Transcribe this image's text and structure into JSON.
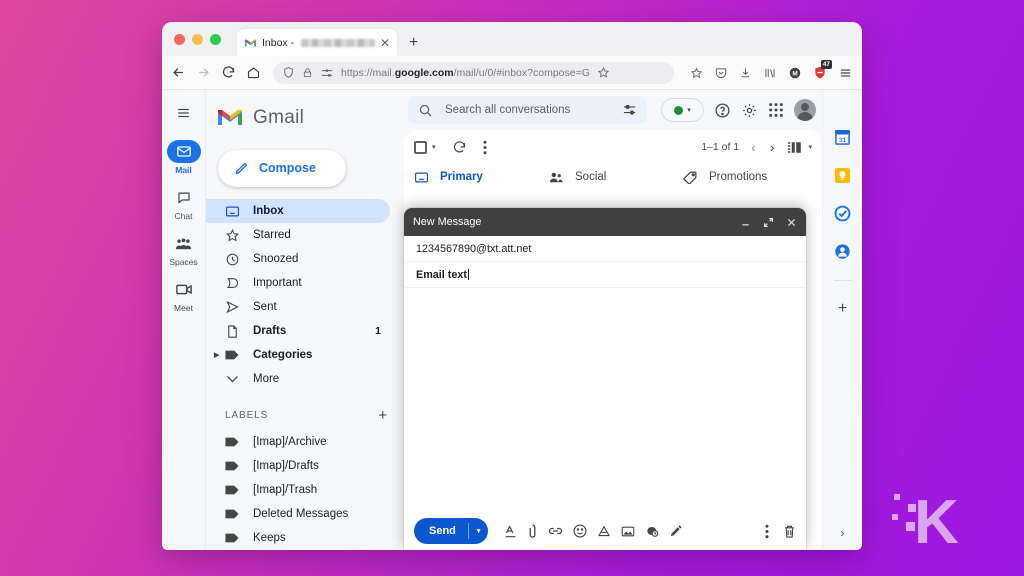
{
  "browser": {
    "tab": {
      "favicon": "gmail-favicon",
      "title": "Inbox - ",
      "redacted": true,
      "close": "✕"
    },
    "newtab_label": "+",
    "nav": {
      "back": "back-arrow",
      "forward": "forward-arrow",
      "reload": "reload",
      "home": "home"
    },
    "omnibox": {
      "shield": "shield-icon",
      "lock": "lock-icon",
      "tracking": "tracking-protection-icon",
      "url_prefix": "https://mail.",
      "url_domain": "google.com",
      "url_suffix": "/mail/u/0/#inbox?compose=G",
      "bookmark": "star-icon"
    },
    "extensions": [
      {
        "name": "pocket-save-icon"
      },
      {
        "name": "pocket-icon"
      },
      {
        "name": "download-icon"
      },
      {
        "name": "library-icon"
      },
      {
        "name": "account-m-icon"
      },
      {
        "name": "adblock-icon",
        "badge": "47"
      }
    ],
    "menu": "hamburger-menu-icon"
  },
  "gmail": {
    "brand": "Gmail",
    "menu_icon": "main-menu-icon",
    "rail": [
      {
        "label": "Mail",
        "icon": "mail-icon",
        "active": true
      },
      {
        "label": "Chat",
        "icon": "chat-icon",
        "active": false
      },
      {
        "label": "Spaces",
        "icon": "spaces-icon",
        "active": false
      },
      {
        "label": "Meet",
        "icon": "meet-icon",
        "active": false
      }
    ],
    "compose_label": "Compose",
    "folders": [
      {
        "label": "Inbox",
        "icon": "inbox-icon",
        "selected": true,
        "count": ""
      },
      {
        "label": "Starred",
        "icon": "star-icon",
        "selected": false,
        "count": ""
      },
      {
        "label": "Snoozed",
        "icon": "clock-icon",
        "selected": false,
        "count": ""
      },
      {
        "label": "Important",
        "icon": "important-icon",
        "selected": false,
        "count": ""
      },
      {
        "label": "Sent",
        "icon": "send-icon",
        "selected": false,
        "count": ""
      },
      {
        "label": "Drafts",
        "icon": "draft-icon",
        "selected": false,
        "count": "1",
        "bold": true
      },
      {
        "label": "Categories",
        "icon": "label-icon",
        "selected": false,
        "count": "",
        "bold": true,
        "expandable": true
      },
      {
        "label": "More",
        "icon": "chevron-down-icon",
        "selected": false,
        "count": ""
      }
    ],
    "labels_header": "LABELS",
    "labels_add": "+",
    "labels": [
      {
        "label": "[Imap]/Archive",
        "icon": "label-icon"
      },
      {
        "label": "[Imap]/Drafts",
        "icon": "label-icon"
      },
      {
        "label": "[Imap]/Trash",
        "icon": "label-icon"
      },
      {
        "label": "Deleted Messages",
        "icon": "label-icon"
      },
      {
        "label": "Keeps",
        "icon": "label-icon"
      }
    ],
    "search": {
      "placeholder": "Search all conversations",
      "search_icon": "search-icon",
      "options_icon": "search-options-icon"
    },
    "topright": {
      "status_dot_color": "#1e8e3e",
      "status_caret": "▾",
      "help_icon": "help-icon",
      "settings_icon": "gear-icon",
      "apps_icon": "google-apps-icon",
      "avatar": "avatar"
    },
    "listtools": {
      "select_all": "select-all-checkbox",
      "select_caret": "▾",
      "refresh_icon": "refresh-icon",
      "more_icon": "more-options-icon",
      "pagination": "1–1 of 1",
      "prev": "‹",
      "next": "›",
      "split_view_icon": "split-pane-icon",
      "split_caret": "▾"
    },
    "tabs": [
      {
        "label": "Primary",
        "icon": "inbox-icon",
        "active": true
      },
      {
        "label": "Social",
        "icon": "social-icon",
        "active": false
      },
      {
        "label": "Promotions",
        "icon": "promotions-tag-icon",
        "active": false
      }
    ],
    "right_rail": [
      {
        "name": "google-calendar-icon"
      },
      {
        "name": "google-keep-icon"
      },
      {
        "name": "google-tasks-icon"
      },
      {
        "name": "google-contacts-icon"
      }
    ],
    "right_rail_add": "+",
    "right_rail_expand": "›"
  },
  "compose": {
    "title": "New Message",
    "minimize": "minimize-icon",
    "expand": "expand-icon",
    "close": "close-icon",
    "to_value": "1234567890@txt.att.net",
    "subject_value": "Email text",
    "body_value": "",
    "send_label": "Send",
    "send_caret": "▾",
    "tools": [
      {
        "name": "format-text-icon",
        "glyph": "A"
      },
      {
        "name": "attach-file-icon"
      },
      {
        "name": "insert-link-icon"
      },
      {
        "name": "insert-emoji-icon"
      },
      {
        "name": "insert-drive-icon"
      },
      {
        "name": "insert-photo-icon"
      },
      {
        "name": "confidential-mode-icon"
      },
      {
        "name": "insert-signature-icon"
      }
    ],
    "more_options": "more-options-icon",
    "discard": "trash-icon"
  },
  "watermark": {
    "glyph": "K"
  },
  "colors": {
    "accent_blue": "#0b57d0",
    "compose_header": "#404040",
    "bg_gradient_start": "#e0479f",
    "bg_gradient_end": "#9b18e0",
    "status_green": "#1e8e3e"
  }
}
